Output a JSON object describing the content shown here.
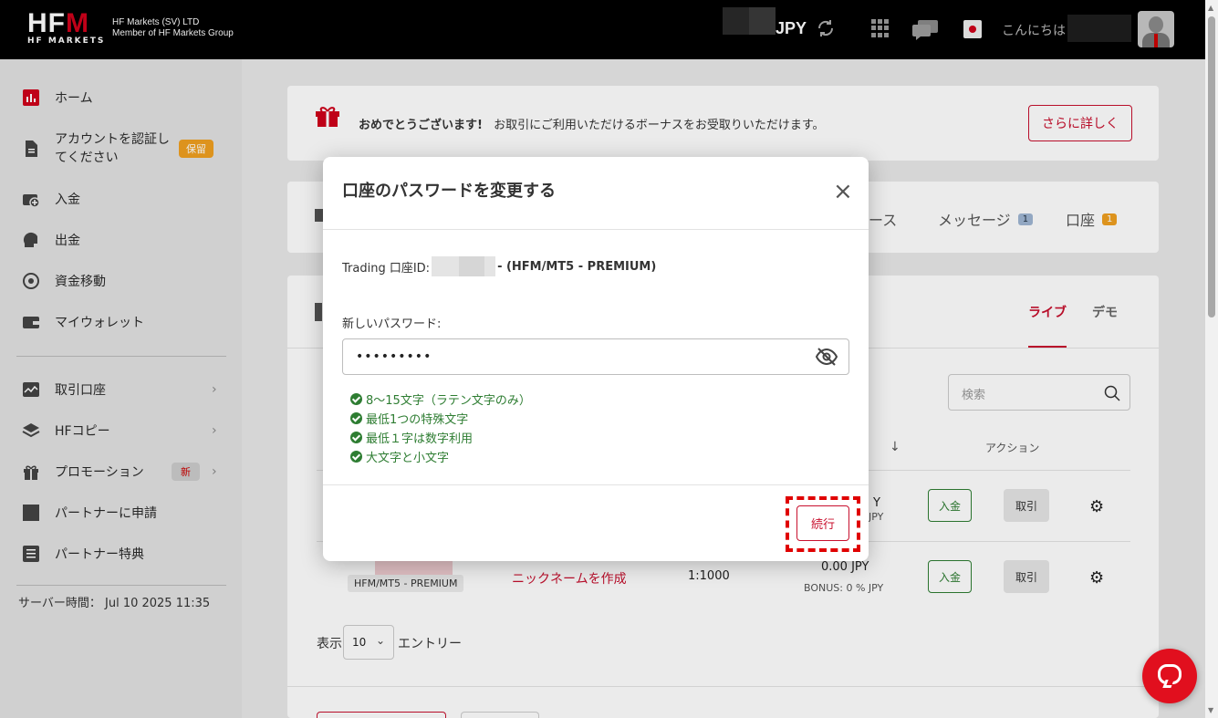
{
  "topbar": {
    "logo_text": "HFM",
    "logo_sub": "HF MARKETS",
    "company_line1": "HF Markets (SV) LTD",
    "company_line2": "Member of HF Markets Group",
    "currency": "JPY",
    "greeting": "こんにちは"
  },
  "sidebar": {
    "items": [
      {
        "label": "ホーム"
      },
      {
        "label": "アカウントを認証し",
        "label2": "てください",
        "badge": "保留"
      },
      {
        "label": "入金"
      },
      {
        "label": "出金"
      },
      {
        "label": "資金移動"
      },
      {
        "label": "マイウォレット"
      },
      {
        "label": "取引口座"
      },
      {
        "label": "HFコピー"
      },
      {
        "label": "プロモーション",
        "badge": "新"
      },
      {
        "label": "パートナーに申請"
      },
      {
        "label": "パートナー特典"
      }
    ],
    "server_time": "サーバー時間： Jul 10 2025 11:35"
  },
  "promo": {
    "title": "おめでとうございます!",
    "text": "お取引にご利用いただけるボーナスをお受取りいただけます。",
    "button": "さらに詳しく"
  },
  "tabs": {
    "partial_label": "ース",
    "messages": "メッセージ",
    "messages_count": "1",
    "accounts": "口座",
    "accounts_count": "1"
  },
  "accounts_panel": {
    "tab_live": "ライブ",
    "tab_demo": "デモ",
    "search_placeholder": "検索",
    "col_action": "アクション",
    "rows": [
      {
        "leverage": "",
        "balance_tail": "Y",
        "bonus_tail": "JPY",
        "deposit": "入金",
        "trade": "取引"
      },
      {
        "account_type": "HFM/MT5 - PREMIUM",
        "nickname": "ニックネームを作成",
        "leverage": "1:1000",
        "balance": "0.00 JPY",
        "bonus": "BONUS: 0 % JPY",
        "deposit": "入金",
        "trade": "取引"
      }
    ],
    "show_label": "表示",
    "page_size": "10",
    "entries_label": "エントリー"
  },
  "modal": {
    "title": "口座のパスワードを変更する",
    "account_prefix": "Trading 口座ID:",
    "account_suffix": "- (HFM/MT5 - PREMIUM)",
    "password_label": "新しいパスワード:",
    "password_value": "•••••••••",
    "rules": [
      "8〜15文字（ラテン文字のみ）",
      "最低1つの特殊文字",
      "最低１字は数字利用",
      "大文字と小文字"
    ],
    "continue_button": "続行"
  },
  "colors": {
    "brand_red": "#c8102e",
    "success_green": "#2e7d32",
    "badge_orange": "#f0a020"
  }
}
